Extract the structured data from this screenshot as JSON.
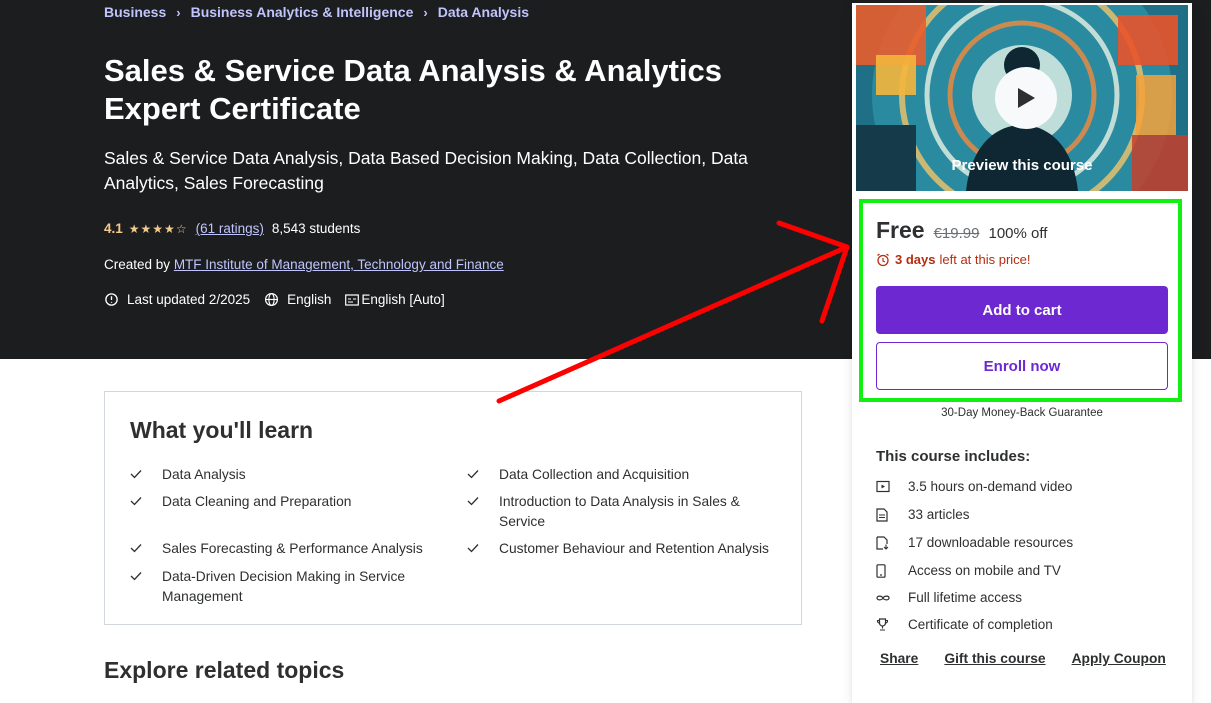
{
  "breadcrumb": [
    "Business",
    "Business Analytics & Intelligence",
    "Data Analysis"
  ],
  "course": {
    "title": "Sales & Service Data Analysis & Analytics Expert Certificate",
    "subtitle": "Sales & Service Data Analysis, Data Based Decision Making, Data Collection, Data Analytics, Sales Forecasting",
    "rating": "4.1",
    "ratings_count": "(61 ratings)",
    "students": "8,543 students",
    "created_by_label": "Created by",
    "instructor": "MTF Institute of Management, Technology and Finance",
    "last_updated": "Last updated 2/2025",
    "language": "English",
    "captions": "English [Auto]"
  },
  "learn": {
    "title": "What you'll learn",
    "items": [
      "Data Analysis",
      "Data Collection and Acquisition",
      "Data Cleaning and Preparation",
      "Introduction to Data Analysis in Sales & Service",
      "Sales Forecasting & Performance Analysis",
      "Customer Behaviour and Retention Analysis",
      "Data-Driven Decision Making in Service Management"
    ]
  },
  "related_title": "Explore related topics",
  "sidebar": {
    "preview_label": "Preview this course",
    "price": "Free",
    "original_price": "€19.99",
    "discount": "100% off",
    "timer_bold": "3 days",
    "timer_rest": "left at this price!",
    "add_to_cart": "Add to cart",
    "enroll_now": "Enroll now",
    "guarantee": "30-Day Money-Back Guarantee",
    "includes_title": "This course includes:",
    "includes": [
      {
        "icon": "video-icon",
        "label": "3.5 hours on-demand video"
      },
      {
        "icon": "article-icon",
        "label": "33 articles"
      },
      {
        "icon": "download-file-icon",
        "label": "17 downloadable resources"
      },
      {
        "icon": "mobile-icon",
        "label": "Access on mobile and TV"
      },
      {
        "icon": "infinity-icon",
        "label": "Full lifetime access"
      },
      {
        "icon": "trophy-icon",
        "label": "Certificate of completion"
      }
    ],
    "links": [
      "Share",
      "Gift this course",
      "Apply Coupon"
    ]
  },
  "colors": {
    "hero_bg": "#1c1d1f",
    "accent_purple": "#6d28d2",
    "star": "#f3ca8c",
    "link_lavender": "#c0c4fc",
    "timer_red": "#b32d0f",
    "highlight_green": "#12f012",
    "annotation_red": "#ff0000"
  }
}
